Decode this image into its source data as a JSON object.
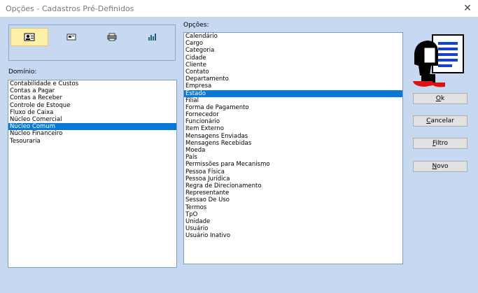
{
  "window": {
    "title": "Opções - Cadastros Pré-Definidos",
    "close": "✕"
  },
  "toolbar": {
    "icons": [
      "user-card-icon",
      "card-icon",
      "printer-icon",
      "chart-icon"
    ],
    "active_index": 0
  },
  "dominio": {
    "label": "Domínio:",
    "items": [
      "Contabilidade e Custos",
      "Contas a Pagar",
      "Contas a Receber",
      "Controle de Estoque",
      "Fluxo de Caixa",
      "Núcleo Comercial",
      "Núcleo Comum",
      "Núcleo Financeiro",
      "Tesouraria"
    ],
    "selected": "Núcleo Comum"
  },
  "opcoes": {
    "label": "Opções:",
    "items": [
      "Calendário",
      "Cargo",
      "Categoria",
      "Cidade",
      "Cliente",
      "Contato",
      "Departamento",
      "Empresa",
      "Estado",
      "Filial",
      "Forma de Pagamento",
      "Fornecedor",
      "Funcionário",
      "Item Externo",
      "Mensagens Enviadas",
      "Mensagens Recebidas",
      "Moeda",
      "País",
      "Permissões para Mecanismo",
      "Pessoa Física",
      "Pessoa Jurídica",
      "Regra de Direcionamento",
      "Representante",
      "Sessao De Uso",
      "Termos",
      "TpO",
      "Unidade",
      "Usuário",
      "Usuário Inativo"
    ],
    "selected": "Estado"
  },
  "buttons": {
    "ok": {
      "first": "O",
      "rest": "k"
    },
    "cancelar": {
      "first": "C",
      "rest": "ancelar"
    },
    "filtro": {
      "first": "F",
      "rest": "iltro"
    },
    "novo": {
      "first": "N",
      "rest": "ovo"
    }
  }
}
